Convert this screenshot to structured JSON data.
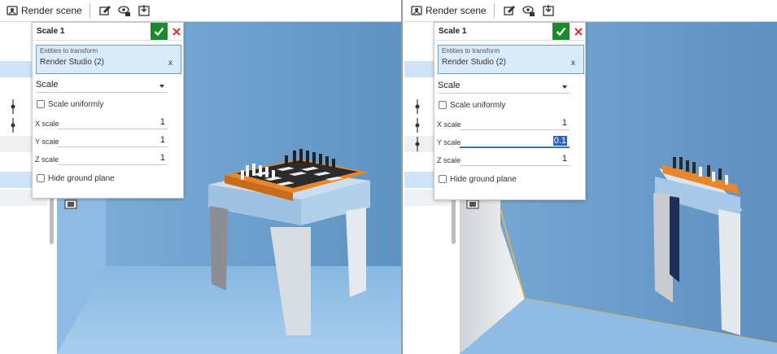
{
  "left": {
    "toolbar": {
      "render_label": "Render scene",
      "icons": [
        "render-scene-icon",
        "appearance-edit-icon",
        "camera-view-icon",
        "export-image-icon"
      ]
    },
    "dialog": {
      "title": "Scale 1",
      "entities_label": "Entities to transform",
      "entities_value": "Render Studio (2)",
      "entities_clear": "x",
      "mode": "Scale",
      "scale_uniformly": "Scale uniformly",
      "x_label": "X scale",
      "x_value": "1",
      "y_label": "Y scale",
      "y_value": "1",
      "z_label": "Z scale",
      "z_value": "1",
      "hide_ground": "Hide ground plane"
    }
  },
  "right": {
    "toolbar": {
      "render_label": "Render scene",
      "icons": [
        "render-scene-icon",
        "appearance-edit-icon",
        "camera-view-icon",
        "export-image-icon"
      ]
    },
    "dialog": {
      "title": "Scale 1",
      "entities_label": "Entities to transform",
      "entities_value": "Render Studio (2)",
      "entities_clear": "x",
      "mode": "Scale",
      "scale_uniformly": "Scale uniformly",
      "x_label": "X scale",
      "x_value": "1",
      "y_label": "Y scale",
      "y_value": "0.1",
      "z_label": "Z scale",
      "z_value": "1",
      "hide_ground": "Hide ground plane"
    }
  },
  "colors": {
    "accent": "#1a8a2a",
    "cancel": "#d9362b",
    "selection": "#cfe5f7",
    "viewport_bg": "#6fa0cc",
    "table_top": "#e8862a",
    "table_body": "#b7d4ec"
  }
}
